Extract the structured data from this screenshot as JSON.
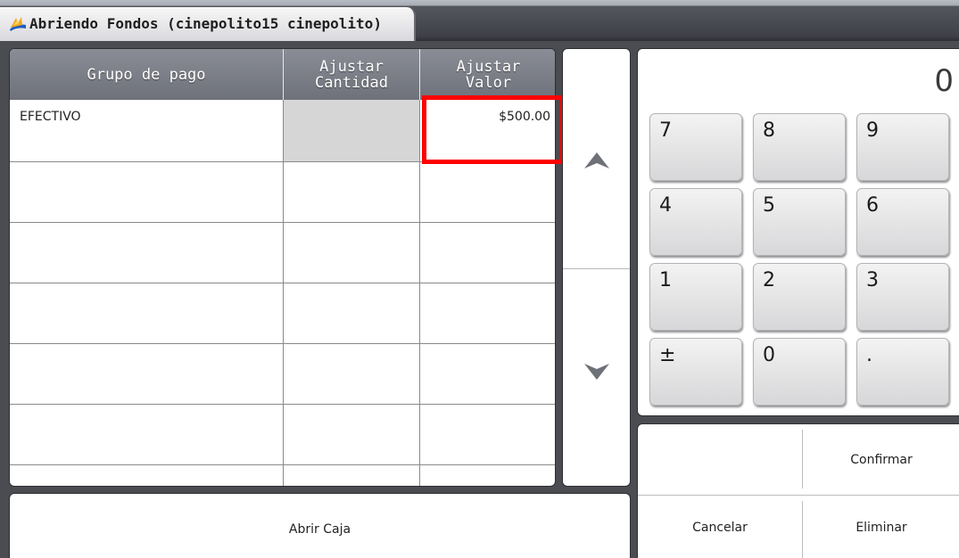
{
  "window": {
    "title": "Abriendo Fondos (cinepolito15  cinepolito)"
  },
  "grid": {
    "columns": [
      {
        "label": "Grupo de pago"
      },
      {
        "label": "Ajustar\nCantidad"
      },
      {
        "label": "Ajustar\nValor"
      }
    ],
    "rows": [
      {
        "grupo": "EFECTIVO",
        "cantidad": "",
        "valor": "$500.00"
      },
      {
        "grupo": "",
        "cantidad": "",
        "valor": ""
      },
      {
        "grupo": "",
        "cantidad": "",
        "valor": ""
      },
      {
        "grupo": "",
        "cantidad": "",
        "valor": ""
      },
      {
        "grupo": "",
        "cantidad": "",
        "valor": ""
      },
      {
        "grupo": "",
        "cantidad": "",
        "valor": ""
      }
    ]
  },
  "scroll": {
    "up_icon": "triangle-up-icon",
    "down_icon": "triangle-down-icon"
  },
  "numpad": {
    "display": "0",
    "keys": [
      "7",
      "8",
      "9",
      "4",
      "5",
      "6",
      "1",
      "2",
      "3",
      "±",
      "0",
      "."
    ]
  },
  "actions": {
    "confirm_label": "Confirmar",
    "cancel_label": "Cancelar",
    "delete_label": "Eliminar",
    "open_label": "Abrir Caja"
  },
  "colors": {
    "highlight": "#ff0000",
    "header": "#7a7d86",
    "shaded_cell": "#d6d6d6"
  }
}
